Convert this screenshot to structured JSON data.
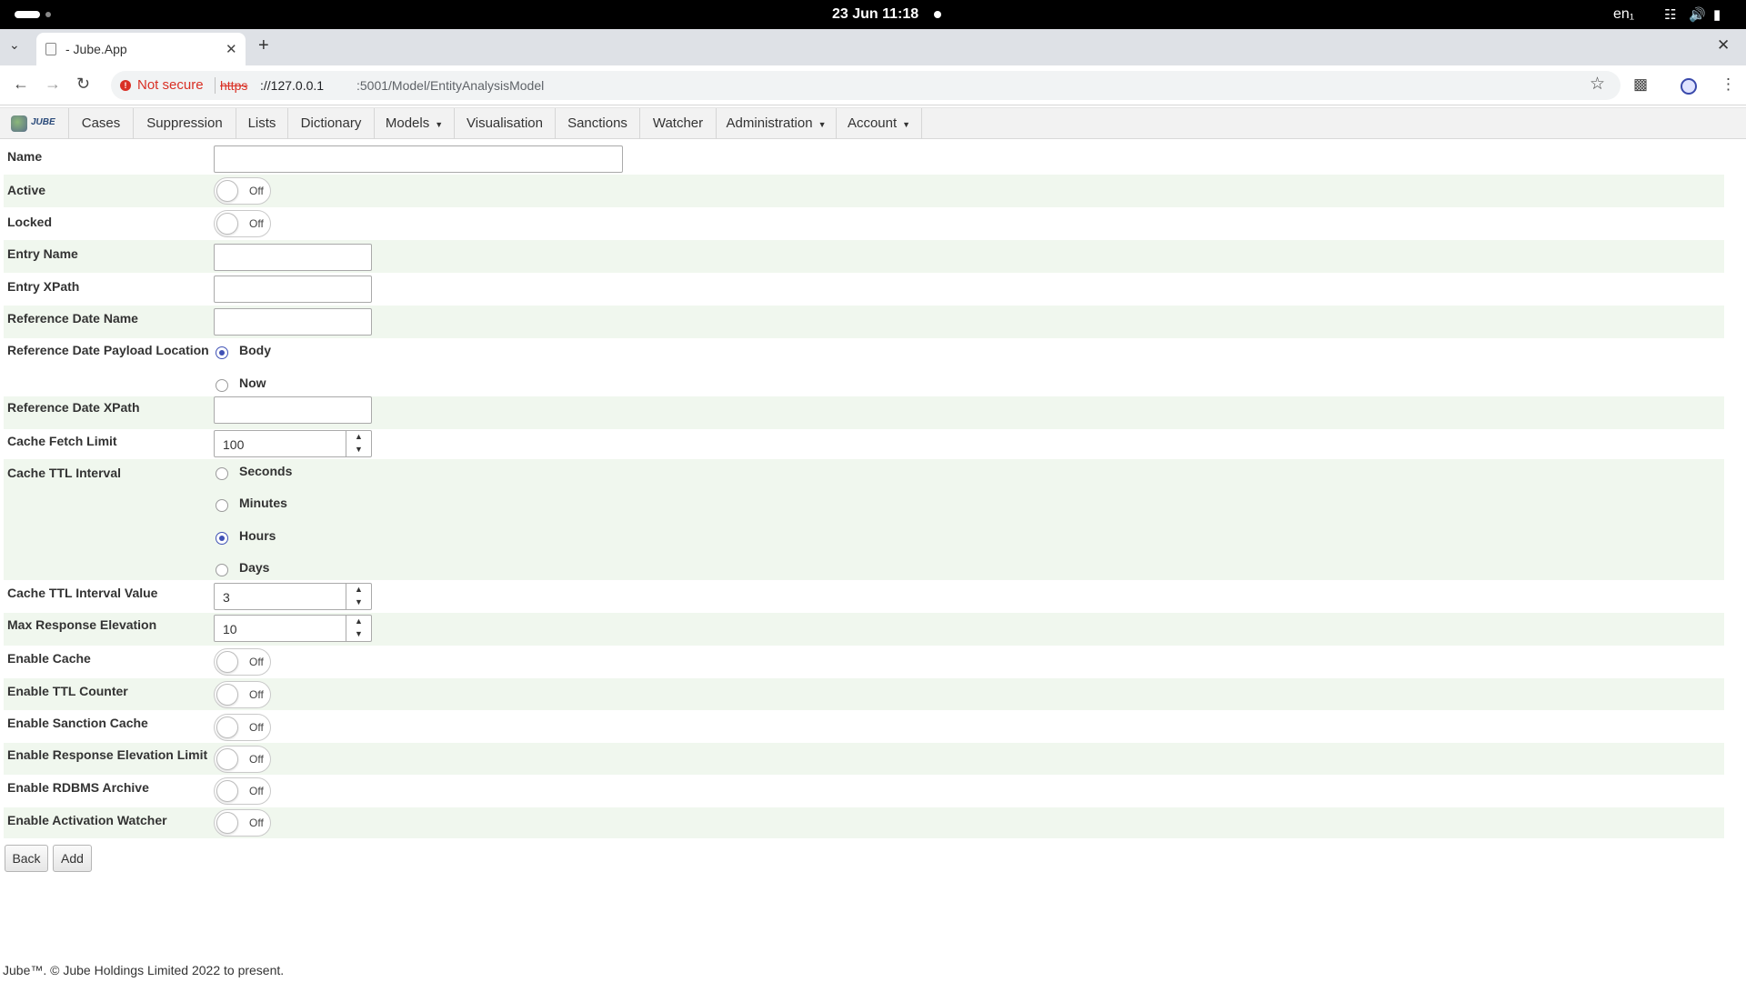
{
  "os": {
    "clock": "23 Jun  11:18",
    "lang": "en₁"
  },
  "browser": {
    "tab_title": "- Jube.App",
    "new_tab": "+",
    "security_label": "Not secure",
    "url_scheme": "https",
    "url_host": "://127.0.0.1",
    "url_path": ":5001/Model/EntityAnalysisModel"
  },
  "menu": {
    "logo_text": "JUBE",
    "items": [
      {
        "label": "Cases"
      },
      {
        "label": "Suppression"
      },
      {
        "label": "Lists"
      },
      {
        "label": "Dictionary"
      },
      {
        "label": "Models"
      },
      {
        "label": "Visualisation"
      },
      {
        "label": "Sanctions"
      },
      {
        "label": "Watcher"
      },
      {
        "label": "Administration"
      },
      {
        "label": "Account"
      }
    ]
  },
  "form": {
    "name": {
      "label": "Name",
      "value": ""
    },
    "active": {
      "label": "Active",
      "state": "Off"
    },
    "locked": {
      "label": "Locked",
      "state": "Off"
    },
    "entry_name": {
      "label": "Entry Name",
      "value": ""
    },
    "entry_xpath": {
      "label": "Entry XPath",
      "value": ""
    },
    "reference_date_name": {
      "label": "Reference Date Name",
      "value": ""
    },
    "reference_date_payload_location": {
      "label": "Reference Date Payload Location",
      "options": [
        "Body",
        "Now"
      ],
      "selected": "Body"
    },
    "reference_date_xpath": {
      "label": "Reference Date XPath",
      "value": ""
    },
    "cache_fetch_limit": {
      "label": "Cache Fetch Limit",
      "value": "100"
    },
    "cache_ttl_interval": {
      "label": "Cache TTL Interval",
      "options": [
        "Seconds",
        "Minutes",
        "Hours",
        "Days"
      ],
      "selected": "Hours"
    },
    "cache_ttl_interval_value": {
      "label": "Cache TTL Interval Value",
      "value": "3"
    },
    "max_response_elevation": {
      "label": "Max Response Elevation",
      "value": "10"
    },
    "enable_cache": {
      "label": "Enable Cache",
      "state": "Off"
    },
    "enable_ttl_counter": {
      "label": "Enable TTL Counter",
      "state": "Off"
    },
    "enable_sanction_cache": {
      "label": "Enable Sanction Cache",
      "state": "Off"
    },
    "enable_response_elevation_limit": {
      "label": "Enable Response Elevation Limit",
      "state": "Off"
    },
    "enable_rdbms_archive": {
      "label": "Enable RDBMS Archive",
      "state": "Off"
    },
    "enable_activation_watcher": {
      "label": "Enable Activation Watcher",
      "state": "Off"
    }
  },
  "actions": {
    "back": "Back",
    "add": "Add"
  },
  "footer": "Jube™. © Jube Holdings Limited 2022 to present.",
  "colors": {
    "row_alt": "#f0f7ee",
    "radio_selected": "#3f51b5",
    "insecure": "#d93025"
  }
}
